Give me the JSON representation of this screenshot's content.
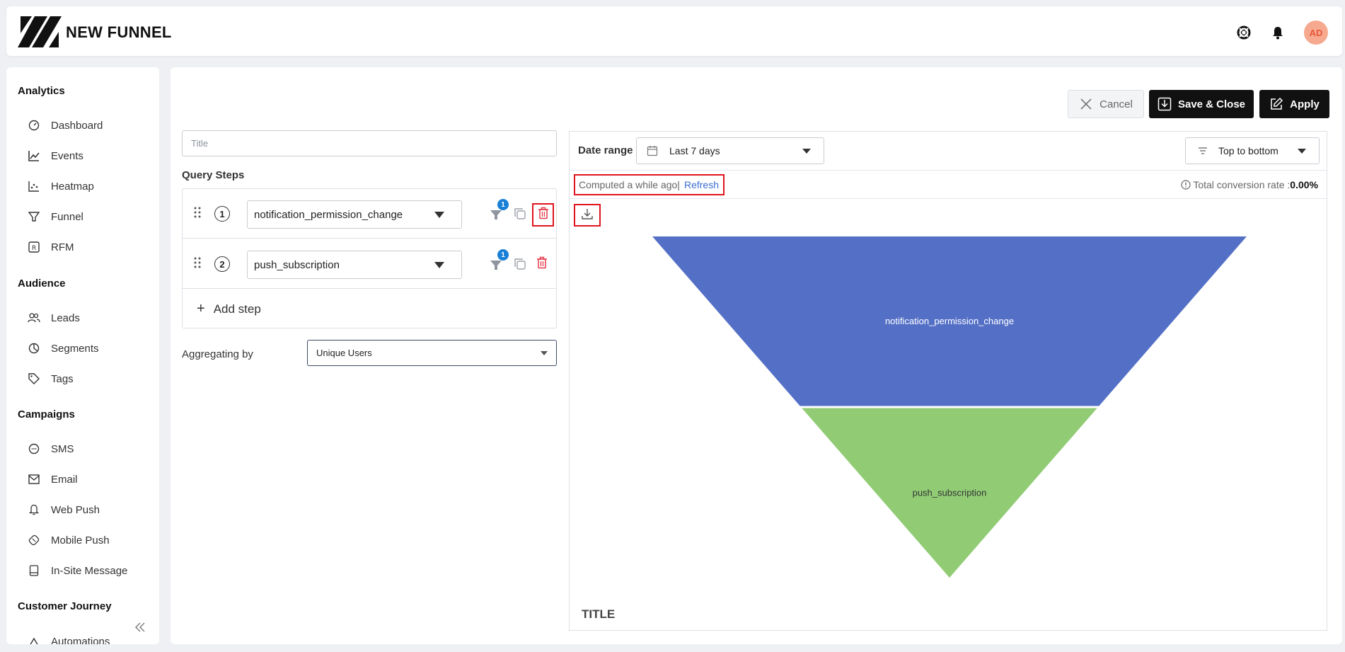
{
  "header": {
    "title": "NEW FUNNEL",
    "avatar_initials": "AD",
    "icons": [
      "help-icon",
      "bell-icon"
    ]
  },
  "sidebar": {
    "sections": [
      {
        "label": "Analytics",
        "items": [
          "Dashboard",
          "Events",
          "Heatmap",
          "Funnel",
          "RFM"
        ]
      },
      {
        "label": "Audience",
        "items": [
          "Leads",
          "Segments",
          "Tags"
        ]
      },
      {
        "label": "Campaigns",
        "items": [
          "SMS",
          "Email",
          "Web Push",
          "Mobile Push",
          "In-Site Message"
        ]
      },
      {
        "label": "Customer Journey",
        "items": [
          "Automations"
        ]
      }
    ]
  },
  "toolbar": {
    "cancel_label": "Cancel",
    "save_label": "Save & Close",
    "apply_label": "Apply"
  },
  "query": {
    "title_placeholder": "Title",
    "steps_label": "Query Steps",
    "steps": [
      {
        "number": "1",
        "event": "notification_permission_change",
        "filter_count": "1"
      },
      {
        "number": "2",
        "event": "push_subscription",
        "filter_count": "1"
      }
    ],
    "add_step_label": "Add step",
    "aggregating_label": "Aggregating by",
    "aggregating_value": "Unique Users"
  },
  "panel": {
    "date_range_label": "Date range",
    "date_range_value": "Last 7 days",
    "order_value": "Top to bottom",
    "computed_text": "Computed a while ago|",
    "refresh_label": "Refresh",
    "conversion_label": "Total conversion rate :",
    "conversion_value": "0.00%",
    "chart_title": "TITLE"
  },
  "chart_data": {
    "type": "funnel",
    "stages": [
      {
        "name": "notification_permission_change",
        "color": "#5470c6"
      },
      {
        "name": "push_subscription",
        "color": "#91cc75"
      }
    ],
    "title": "TITLE"
  }
}
